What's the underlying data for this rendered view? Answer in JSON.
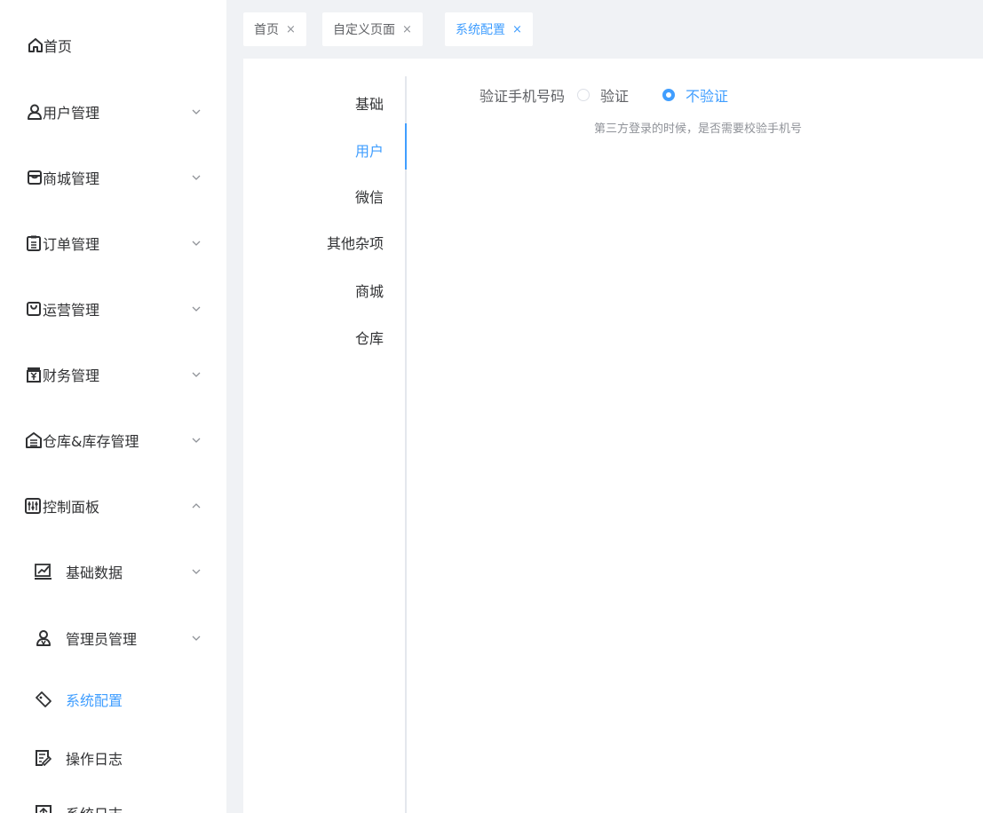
{
  "sidebar": {
    "items": [
      {
        "label": "首页",
        "icon": "home-icon",
        "arrow": ""
      },
      {
        "label": "用户管理",
        "icon": "user-icon",
        "arrow": "down"
      },
      {
        "label": "商城管理",
        "icon": "shop-icon",
        "arrow": "down"
      },
      {
        "label": "订单管理",
        "icon": "clipboard-icon",
        "arrow": "down"
      },
      {
        "label": "运营管理",
        "icon": "bag-icon",
        "arrow": "down"
      },
      {
        "label": "财务管理",
        "icon": "yen-box-icon",
        "arrow": "down"
      },
      {
        "label": "仓库&库存管理",
        "icon": "warehouse-icon",
        "arrow": "down"
      },
      {
        "label": "控制面板",
        "icon": "sliders-icon",
        "arrow": "up"
      },
      {
        "label": "基础数据",
        "icon": "chart-icon",
        "arrow": "down"
      },
      {
        "label": "管理员管理",
        "icon": "admin-icon",
        "arrow": "down"
      },
      {
        "label": "系统配置",
        "icon": "tag-icon",
        "arrow": ""
      },
      {
        "label": "操作日志",
        "icon": "edit-doc-icon",
        "arrow": ""
      },
      {
        "label": "系统日志",
        "icon": "log-icon",
        "arrow": ""
      }
    ],
    "active": "系统配置"
  },
  "tabs": [
    {
      "label": "首页",
      "close": "×"
    },
    {
      "label": "自定义页面",
      "close": "×"
    },
    {
      "label": "系统配置",
      "close": "×"
    }
  ],
  "side_tabs": [
    "基础",
    "用户",
    "微信",
    "其他杂项",
    "商城",
    "仓库"
  ],
  "active_side_tab": "用户",
  "form": {
    "label": "验证手机号码",
    "options": [
      "验证",
      "不验证"
    ],
    "selected": "不验证",
    "hint": "第三方登录的时候，是否需要校验手机号"
  },
  "colors": {
    "accent": "#409eff",
    "text": "#303133",
    "muted": "#909399",
    "background": "#f0f2f5"
  }
}
